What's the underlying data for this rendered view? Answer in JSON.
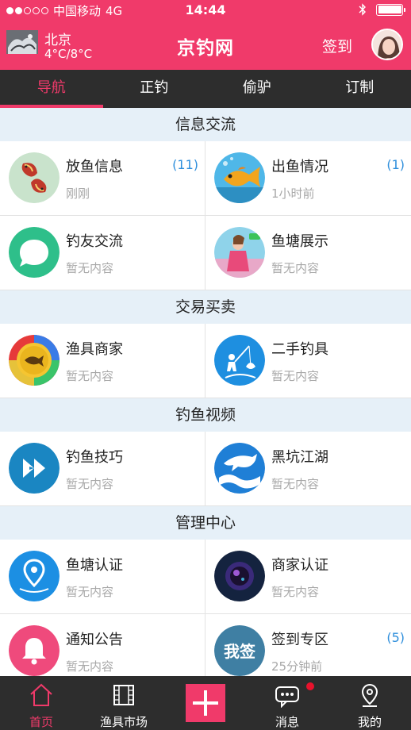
{
  "status_bar": {
    "carrier": "中国移动",
    "network": "4G",
    "time": "14:44"
  },
  "header": {
    "city": "北京",
    "temperature": "4°C/8°C",
    "title": "京钓网",
    "signin_label": "签到"
  },
  "tabs": [
    {
      "label": "导航",
      "active": true
    },
    {
      "label": "正钓",
      "active": false
    },
    {
      "label": "偷驴",
      "active": false
    },
    {
      "label": "订制",
      "active": false
    }
  ],
  "sections": [
    {
      "title": "信息交流",
      "items": [
        {
          "title": "放鱼信息",
          "sub": "刚刚",
          "count": "(11)",
          "icon": "koi-fish-icon"
        },
        {
          "title": "出鱼情况",
          "sub": "1小时前",
          "count": "(1)",
          "icon": "goldfish-icon"
        },
        {
          "title": "钓友交流",
          "sub": "暂无内容",
          "count": "",
          "icon": "chat-bubble-icon"
        },
        {
          "title": "鱼塘展示",
          "sub": "暂无内容",
          "count": "",
          "icon": "pond-photo-icon"
        }
      ]
    },
    {
      "title": "交易买卖",
      "items": [
        {
          "title": "渔具商家",
          "sub": "暂无内容",
          "count": "",
          "icon": "fish-coin-icon"
        },
        {
          "title": "二手钓具",
          "sub": "暂无内容",
          "count": "",
          "icon": "angler-icon"
        }
      ]
    },
    {
      "title": "钓鱼视频",
      "items": [
        {
          "title": "钓鱼技巧",
          "sub": "暂无内容",
          "count": "",
          "icon": "play-icon"
        },
        {
          "title": "黑坑江湖",
          "sub": "暂无内容",
          "count": "",
          "icon": "dolphin-icon"
        }
      ]
    },
    {
      "title": "管理中心",
      "items": [
        {
          "title": "鱼塘认证",
          "sub": "暂无内容",
          "count": "",
          "icon": "location-pin-icon"
        },
        {
          "title": "商家认证",
          "sub": "暂无内容",
          "count": "",
          "icon": "lens-icon"
        },
        {
          "title": "通知公告",
          "sub": "暂无内容",
          "count": "",
          "icon": "bell-icon"
        },
        {
          "title": "签到专区",
          "sub": "25分钟前",
          "count": "(5)",
          "icon": "signin-badge-icon",
          "badge_text": "我签"
        }
      ]
    }
  ],
  "bottom_nav": [
    {
      "label": "首页",
      "icon": "home-icon",
      "active": true
    },
    {
      "label": "渔具市场",
      "icon": "film-icon",
      "active": false
    },
    {
      "label": "",
      "icon": "plus-icon",
      "active": false
    },
    {
      "label": "消息",
      "icon": "message-icon",
      "active": false,
      "has_badge": true
    },
    {
      "label": "我的",
      "icon": "profile-pin-icon",
      "active": false
    }
  ],
  "colors": {
    "brand": "#f03a6a",
    "dark_bar": "#2d2d2d",
    "section_bg": "#e6f0f8",
    "count_blue": "#2f8fdc",
    "badge_red": "#e8122c"
  }
}
